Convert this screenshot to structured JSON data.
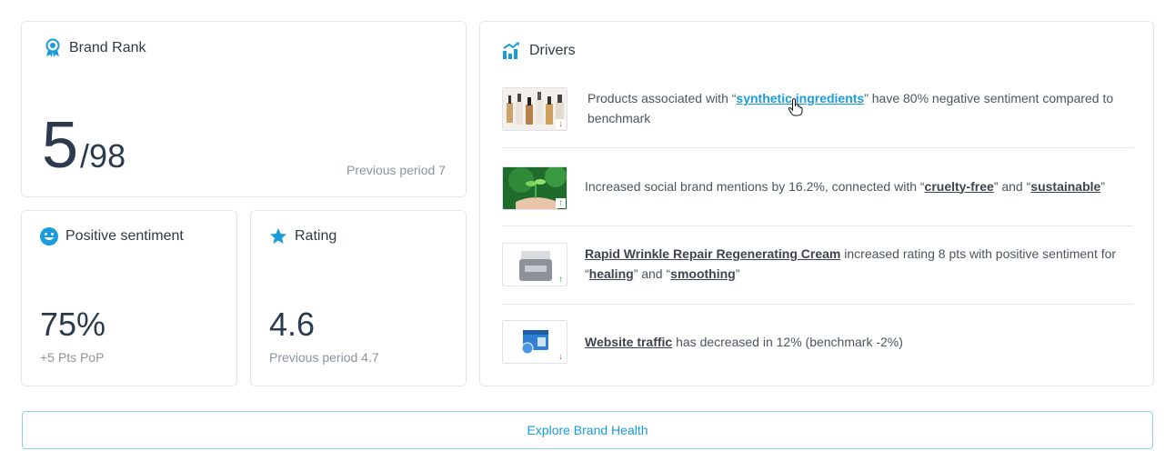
{
  "brand_rank": {
    "title": "Brand Rank",
    "rank": "5",
    "total": "/98",
    "previous": "Previous period 7",
    "icon": "award-ribbon-icon"
  },
  "positive_sentiment": {
    "title": "Positive sentiment",
    "value": "75%",
    "sub": "+5 Pts PoP",
    "icon": "smiley-face-icon"
  },
  "rating": {
    "title": "Rating",
    "value": "4.6",
    "sub": "Previous period 4.7",
    "icon": "star-icon"
  },
  "drivers": {
    "title": "Drivers",
    "icon": "bar-chart-trend-icon",
    "items": [
      {
        "thumb": "serum-bottles-thumbnail",
        "trend": "down",
        "trend_glyph": "↓",
        "t1": "Products associated with “",
        "link": "synthetic ingredients",
        "t2": "” have 80% negative sentiment compared to benchmark"
      },
      {
        "thumb": "plant-in-hands-thumbnail",
        "trend": "up",
        "trend_glyph": "↑",
        "t1": "Increased social brand mentions by 16.2%, connected with “",
        "b1": "cruelty-free",
        "t2": "” and “",
        "b2": "sustainable",
        "t3": "”"
      },
      {
        "thumb": "cream-jar-thumbnail",
        "trend": "up",
        "trend_glyph": "↑",
        "b1": "Rapid Wrinkle Repair Regenerating Cream",
        "t1": " increased rating 8 pts with positive sentiment for “",
        "b2": "healing",
        "t2": "” and “",
        "b3": "smoothing",
        "t3": "”"
      },
      {
        "thumb": "browser-window-thumbnail",
        "trend": "down",
        "trend_glyph": "↓",
        "b1": "Website traffic",
        "t1": " has decreased in 12% (benchmark -2%)"
      }
    ]
  },
  "explore_button": "Explore Brand Health",
  "colors": {
    "accent": "#1a9bdc",
    "up": "#28a745",
    "down": "#e5484d",
    "text_dark": "#2b3a4d",
    "text_muted": "#8a94a0"
  }
}
